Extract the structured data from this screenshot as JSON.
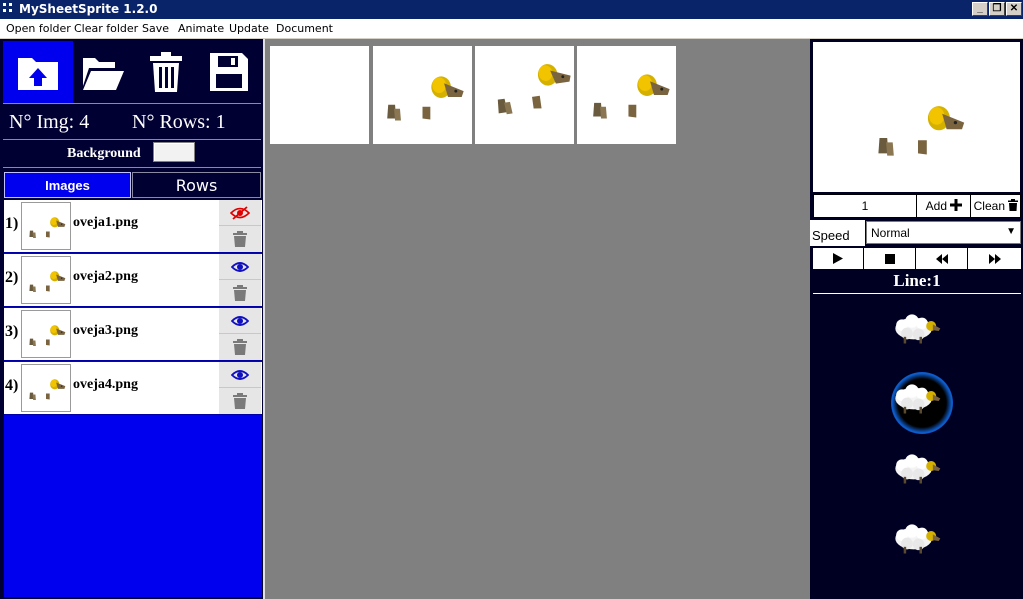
{
  "window": {
    "title": "MySheetSprite 1.2.0",
    "minimize": "_",
    "restore": "❐",
    "close": "✕"
  },
  "menu": [
    "Open folder",
    "Clear folder",
    "Save",
    "Animate",
    "Update",
    "Document"
  ],
  "left": {
    "img_count_label": "N° Img: 4",
    "rows_count_label": "N° Rows: 1",
    "background_label": "Background",
    "tabs": {
      "images": "Images",
      "rows": "Rows"
    },
    "items": [
      {
        "num": "1)",
        "name": "oveja1.png",
        "visible": false
      },
      {
        "num": "2)",
        "name": "oveja2.png",
        "visible": true
      },
      {
        "num": "3)",
        "name": "oveja3.png",
        "visible": true
      },
      {
        "num": "4)",
        "name": "oveja4.png",
        "visible": true
      }
    ]
  },
  "right": {
    "frame_number": "1",
    "add_label": "Add",
    "clean_label": "Clean",
    "speed_label": "Speed",
    "speed_value": "Normal",
    "line_label": "Line:1"
  },
  "colors": {
    "accent_blue": "#0000ee",
    "dark_panel": "#000033",
    "canvas_gray": "#808080",
    "hidden_red": "#e00000",
    "eye_blue": "#1010c0"
  }
}
